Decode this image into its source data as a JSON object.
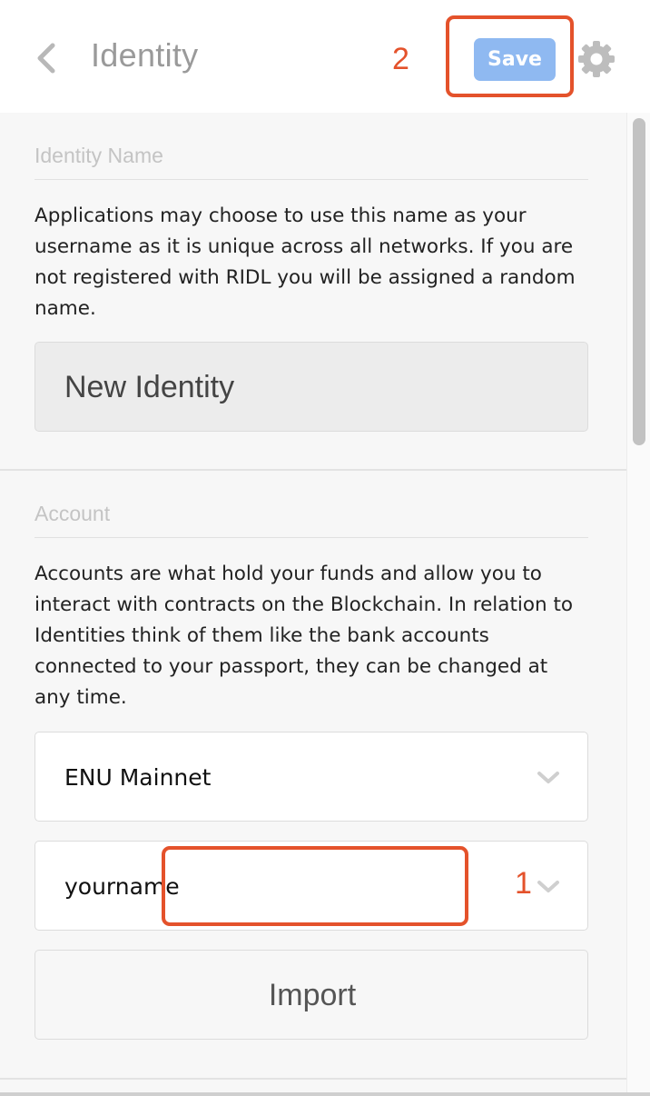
{
  "header": {
    "title": "Identity",
    "back_icon": "chevron-left-icon",
    "save_label": "Save",
    "settings_icon": "gear-icon"
  },
  "annotations": {
    "step_one": "1",
    "step_two": "2",
    "highlight_color": "#e4522b"
  },
  "identity_name_section": {
    "heading": "Identity Name",
    "description": "Applications may choose to use this name as your username as it is unique across all networks. If you are not registered with RIDL you will be assigned a random name.",
    "input_value": "New Identity"
  },
  "account_section": {
    "heading": "Account",
    "description": "Accounts are what hold your funds and allow you to interact with contracts on the Blockchain. In relation to Identities think of them like the bank accounts connected to your passport, they can be changed at any time.",
    "network_select": "ENU Mainnet",
    "account_select": "yourname",
    "import_label": "Import"
  },
  "colors": {
    "save_button": "#8fb9f1",
    "panel_background": "#f7f7f7"
  }
}
